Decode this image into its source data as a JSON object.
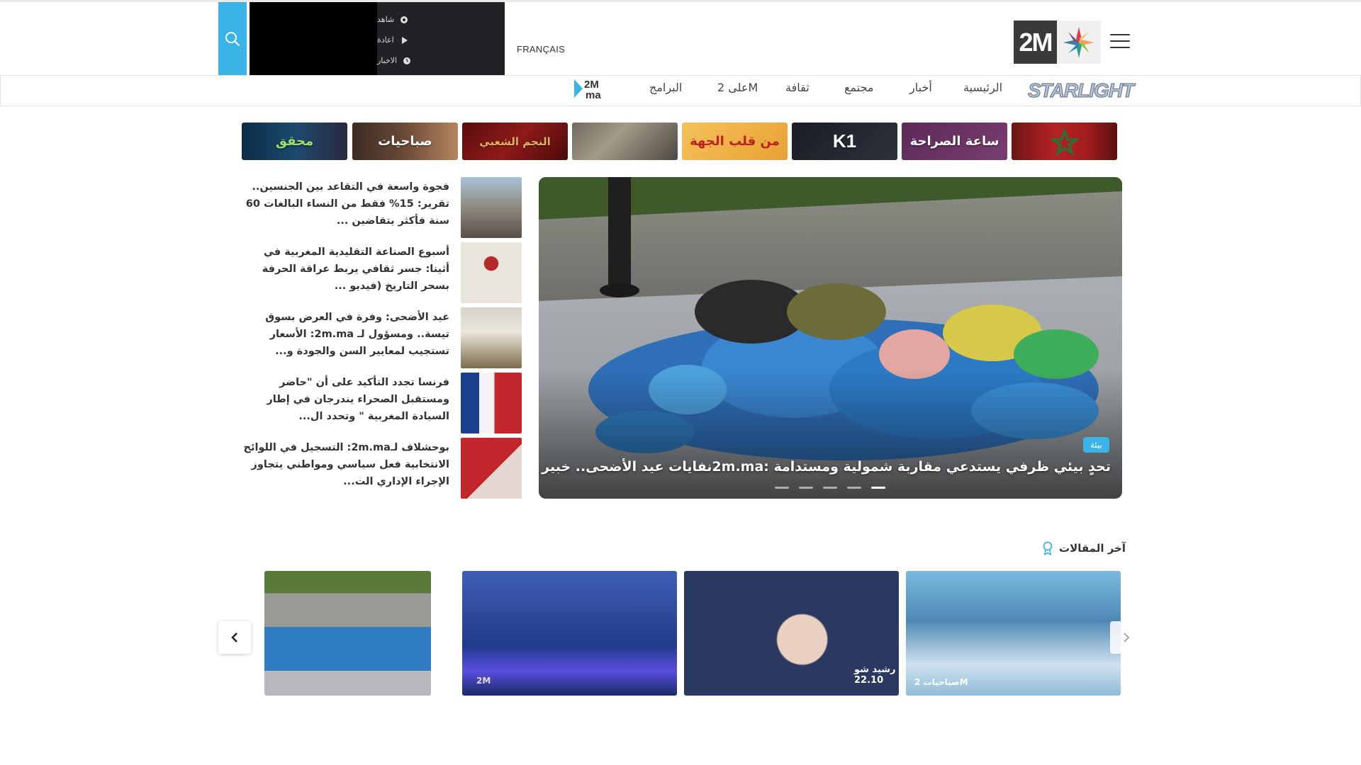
{
  "header": {
    "language_link": "FRANÇAIS",
    "player_menu": [
      {
        "label": "شاهد",
        "icon": "record-icon"
      },
      {
        "label": "اعادة",
        "icon": "play-icon"
      },
      {
        "label": "الاخبار",
        "icon": "clock-icon"
      }
    ],
    "logo_text": "2M"
  },
  "nav": {
    "brand": "STARLIGHT",
    "items": [
      "الرئيسية",
      "أخبار",
      "مجتمع",
      "ثقافة",
      "على 2M",
      "البرامج"
    ],
    "partner_logo": "2M ma"
  },
  "programs": [
    "محقق",
    "صباحيات",
    "النجم الشعبي",
    "",
    "من قلب الجهة",
    "K1",
    "ساعة الصراحة",
    ""
  ],
  "hero": {
    "tag": "بيئة",
    "title": "تحدٍ بيئي ظرفي يستدعي مقاربة شمولية ومستدامة :2m.maنفايات عيد الأضحى.. خبير لـ",
    "slides": 5,
    "active_slide": 5
  },
  "news": [
    {
      "title": "فجوة واسعة في التقاعد بين الجنسين.. تقرير: 15% فقط من النساء البالغات 60 سنة فأكثر يتقاضين ..."
    },
    {
      "title": "أسبوع الصناعة التقليدية المغربية في أثينا: جسر ثقافي يربط عراقة الحرفة بسحر التاريخ (فيديو ..."
    },
    {
      "title": "عيد الأضحى: وفرة في العرض بسوق تيسة.. ومسؤول لـ 2m.ma: الأسعار تستجيب لمعايير السن والجودة و..."
    },
    {
      "title": "فرنسا تجدد التأكيد على أن \"حاضر ومستقبل الصحراء يندرجان في إطار السيادة المغربية \" وتحدد ال..."
    },
    {
      "title": "بوحشلاف لـ2m.ma: التسجيل في اللوائح الانتخابية فعل سياسي ومواطني يتجاوز الإجراء الإداري الت..."
    }
  ],
  "latest": {
    "title": "آخر المقالات",
    "cards": [
      {
        "overlay": "صباحيات 2M"
      },
      {
        "overlay": "رشيد شو 22.10"
      },
      {
        "overlay": "2M"
      },
      {
        "overlay": ""
      }
    ]
  },
  "colors": {
    "accent": "#3ab3e6",
    "player_bg": "#000000",
    "menu_bg": "#222226"
  }
}
